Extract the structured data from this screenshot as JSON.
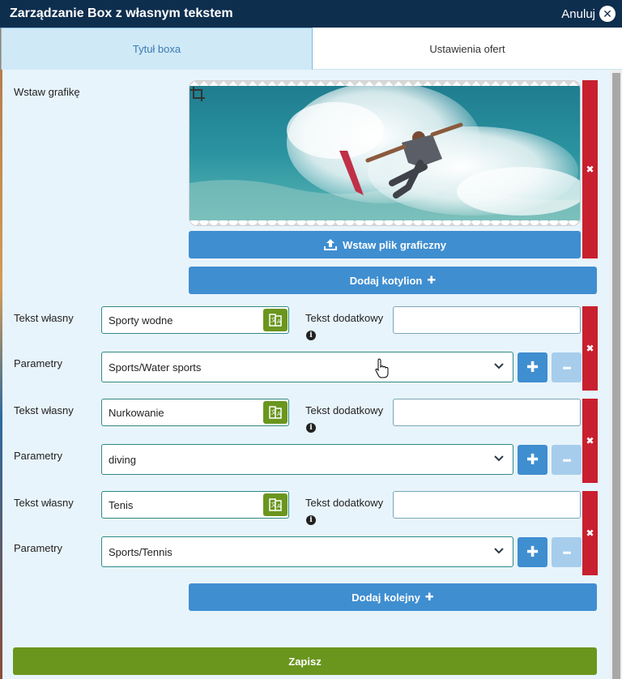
{
  "header": {
    "title": "Zarządzanie Box z własnym tekstem",
    "cancel_label": "Anuluj"
  },
  "tabs": [
    {
      "label": "Tytuł boxa",
      "active": true
    },
    {
      "label": "Ustawienia ofert",
      "active": false
    }
  ],
  "image_section": {
    "label": "Wstaw grafikę",
    "upload_button": "Wstaw plik graficzny",
    "add_anchor_button": "Dodaj kotylion"
  },
  "rows": [
    {
      "text_label": "Tekst własny",
      "text_value": "Sporty wodne",
      "extra_label": "Tekst dodatkowy",
      "extra_value": "",
      "param_label": "Parametry",
      "param_value": "Sports/Water sports"
    },
    {
      "text_label": "Tekst własny",
      "text_value": "Nurkowanie",
      "extra_label": "Tekst dodatkowy",
      "extra_value": "",
      "param_label": "Parametry",
      "param_value": "diving"
    },
    {
      "text_label": "Tekst własny",
      "text_value": "Tenis",
      "extra_label": "Tekst dodatkowy",
      "extra_value": "",
      "param_label": "Parametry",
      "param_value": "Sports/Tennis"
    }
  ],
  "add_next_button": "Dodaj kolejny",
  "save_button": "Zapisz",
  "colors": {
    "header_bg": "#0e2e4e",
    "blue": "#3f8ed0",
    "green": "#6a961e",
    "red": "#c8202e",
    "light_blue": "#a7cdec",
    "panel_bg": "#e8f4fb"
  },
  "icons": {
    "cancel": "close-circle-icon",
    "crop": "crop-icon",
    "upload": "upload-icon",
    "plus": "plus-icon",
    "translate": "translate-icon",
    "info": "info-icon",
    "chevron": "chevron-down-icon",
    "delete": "x-icon",
    "more": "ellipsis-icon",
    "cursor": "hand-pointer-icon"
  }
}
